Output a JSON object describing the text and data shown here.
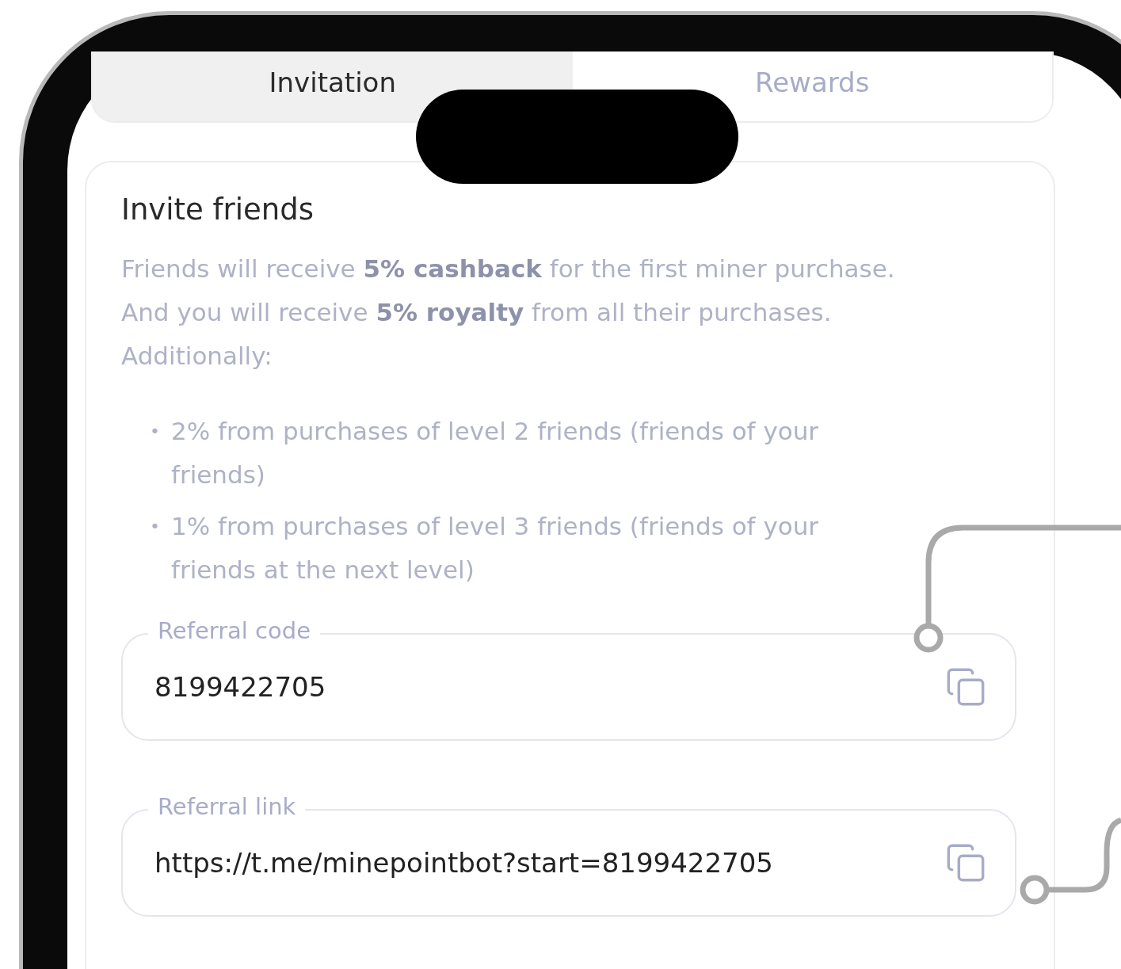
{
  "tabs": [
    {
      "label": "Invitation",
      "selected": true
    },
    {
      "label": "Rewards",
      "selected": false
    }
  ],
  "card": {
    "title": "Invite friends",
    "description_lines": [
      "Friends will receive **5% cashback** for the first miner purchase.",
      "And you will receive **5% royalty** from all their purchases.",
      "Additionally:"
    ],
    "bullets": [
      {
        "marker": "•",
        "text": "2% from purchases of level 2 friends (friends of your friends)"
      },
      {
        "marker": "•",
        "text": "1% from purchases of level 3 friends (friends of your friends at the next level)"
      }
    ],
    "fields": [
      {
        "label": "Referral code",
        "value": "8199422705"
      },
      {
        "label": "Referral link",
        "value": "https://t.me/minepointbot?start=8199422705"
      }
    ]
  }
}
